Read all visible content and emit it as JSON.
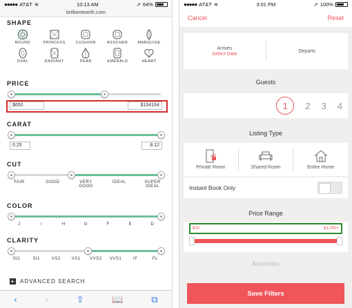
{
  "left": {
    "status": {
      "carrier": "AT&T",
      "time": "10:13 AM",
      "battery": "64%"
    },
    "url": "brilliantearth.com",
    "shape": {
      "title": "SHAPE",
      "items": [
        "ROUND",
        "PRINCESS",
        "CUSHION",
        "ASSCHER",
        "MARQUISE",
        "OVAL",
        "RADIANT",
        "PEAR",
        "EMERALD",
        "HEART"
      ],
      "selected": "ROUND"
    },
    "price": {
      "title": "PRICE",
      "min": "$650",
      "max": "$104164",
      "fill_percent": 62
    },
    "carat": {
      "title": "CARAT",
      "min": "0.25",
      "max": "8.12"
    },
    "cut": {
      "title": "CUT",
      "labels": [
        "FAIR",
        "GOOD",
        "VERY\nGOOD",
        "IDEAL",
        "SUPER\nIDEAL"
      ]
    },
    "color": {
      "title": "COLOR",
      "labels": [
        "J",
        "I",
        "H",
        "G",
        "F",
        "E",
        "D"
      ]
    },
    "clarity": {
      "title": "CLARITY",
      "labels": [
        "SI2",
        "SI1",
        "VS2",
        "VS1",
        "VVS2",
        "VVS1",
        "IF",
        "FL"
      ]
    },
    "advanced": "ADVANCED SEARCH"
  },
  "right": {
    "status": {
      "carrier": "AT&T",
      "time": "3:01 PM",
      "battery": "100%"
    },
    "header": {
      "cancel": "Cancel",
      "reset": "Reset"
    },
    "dates": {
      "arrives": "Arrives",
      "select_date": "Select Date",
      "departs": "Departs"
    },
    "guests": {
      "title": "Guests",
      "options": [
        "1",
        "2",
        "3",
        "4"
      ],
      "selected": "1"
    },
    "listing": {
      "title": "Listing Type",
      "types": [
        "Private Room",
        "Shared Room",
        "Entire Home"
      ],
      "instant_book": "Instant Book Only"
    },
    "price": {
      "title": "Price Range",
      "min": "$10",
      "max": "$1,000+"
    },
    "amenities": "Amenities",
    "save": "Save Filters"
  },
  "colors": {
    "green": "#6cbf97",
    "coral": "#f0555b",
    "ios_blue": "#2a7be4"
  }
}
